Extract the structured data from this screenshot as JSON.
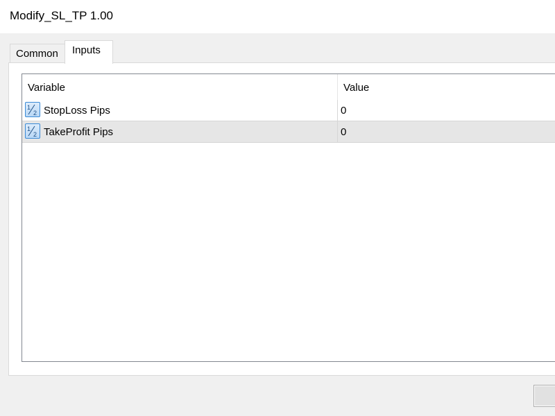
{
  "window": {
    "title": "Modify_SL_TP 1.00"
  },
  "tabs": [
    {
      "label": "Common",
      "active": false
    },
    {
      "label": "Inputs",
      "active": true
    }
  ],
  "grid": {
    "columns": [
      "Variable",
      "Value"
    ],
    "rows": [
      {
        "icon": "fraction-type-icon",
        "variable": "StopLoss Pips",
        "value": "0",
        "selected": false
      },
      {
        "icon": "fraction-type-icon",
        "variable": "TakeProfit Pips",
        "value": "0",
        "selected": true
      }
    ]
  },
  "colors": {
    "selected_row": "#e6e6e6",
    "icon_accent": "#3a8ad6"
  }
}
